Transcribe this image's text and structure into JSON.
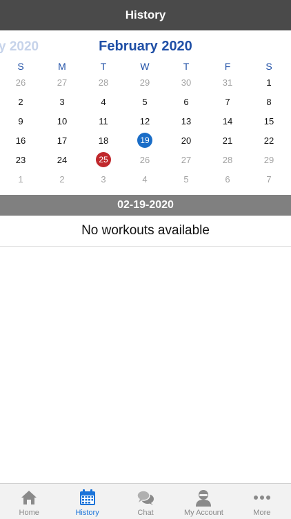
{
  "header": {
    "title": "History"
  },
  "calendar": {
    "prev_month_partial": "y 2020",
    "current_month": "February 2020",
    "weekdays": [
      "S",
      "M",
      "T",
      "W",
      "T",
      "F",
      "S"
    ],
    "days": [
      {
        "label": "26",
        "state": "muted"
      },
      {
        "label": "27",
        "state": "muted"
      },
      {
        "label": "28",
        "state": "muted"
      },
      {
        "label": "29",
        "state": "muted"
      },
      {
        "label": "30",
        "state": "muted"
      },
      {
        "label": "31",
        "state": "muted"
      },
      {
        "label": "1",
        "state": ""
      },
      {
        "label": "2",
        "state": ""
      },
      {
        "label": "3",
        "state": ""
      },
      {
        "label": "4",
        "state": ""
      },
      {
        "label": "5",
        "state": ""
      },
      {
        "label": "6",
        "state": ""
      },
      {
        "label": "7",
        "state": ""
      },
      {
        "label": "8",
        "state": ""
      },
      {
        "label": "9",
        "state": ""
      },
      {
        "label": "10",
        "state": ""
      },
      {
        "label": "11",
        "state": ""
      },
      {
        "label": "12",
        "state": ""
      },
      {
        "label": "13",
        "state": ""
      },
      {
        "label": "14",
        "state": ""
      },
      {
        "label": "15",
        "state": ""
      },
      {
        "label": "16",
        "state": ""
      },
      {
        "label": "17",
        "state": ""
      },
      {
        "label": "18",
        "state": ""
      },
      {
        "label": "19",
        "state": "selected"
      },
      {
        "label": "20",
        "state": ""
      },
      {
        "label": "21",
        "state": ""
      },
      {
        "label": "22",
        "state": ""
      },
      {
        "label": "23",
        "state": ""
      },
      {
        "label": "24",
        "state": ""
      },
      {
        "label": "25",
        "state": "today"
      },
      {
        "label": "26",
        "state": "muted"
      },
      {
        "label": "27",
        "state": "muted"
      },
      {
        "label": "28",
        "state": "muted"
      },
      {
        "label": "29",
        "state": "muted"
      },
      {
        "label": "1",
        "state": "muted"
      },
      {
        "label": "2",
        "state": "muted"
      },
      {
        "label": "3",
        "state": "muted"
      },
      {
        "label": "4",
        "state": "muted"
      },
      {
        "label": "5",
        "state": "muted"
      },
      {
        "label": "6",
        "state": "muted"
      },
      {
        "label": "7",
        "state": "muted"
      }
    ]
  },
  "selected_date": "02-19-2020",
  "workouts": {
    "empty_message": "No workouts available"
  },
  "tabs": [
    {
      "name": "tab-home",
      "icon": "home-icon",
      "label": "Home",
      "active": false
    },
    {
      "name": "tab-history",
      "icon": "calendar-icon",
      "label": "History",
      "active": true
    },
    {
      "name": "tab-chat",
      "icon": "chat-icon",
      "label": "Chat",
      "active": false
    },
    {
      "name": "tab-my-account",
      "icon": "user-icon",
      "label": "My Account",
      "active": false
    },
    {
      "name": "tab-more",
      "icon": "more-icon",
      "label": "More",
      "active": false
    }
  ],
  "colors": {
    "nav_bar": "#4a4a4a",
    "month_title": "#1f4fa6",
    "selected_day": "#1a6dc7",
    "today_day": "#c0282c",
    "date_bar": "#808080",
    "tab_active": "#1a73d9",
    "tab_inactive": "#888888"
  }
}
